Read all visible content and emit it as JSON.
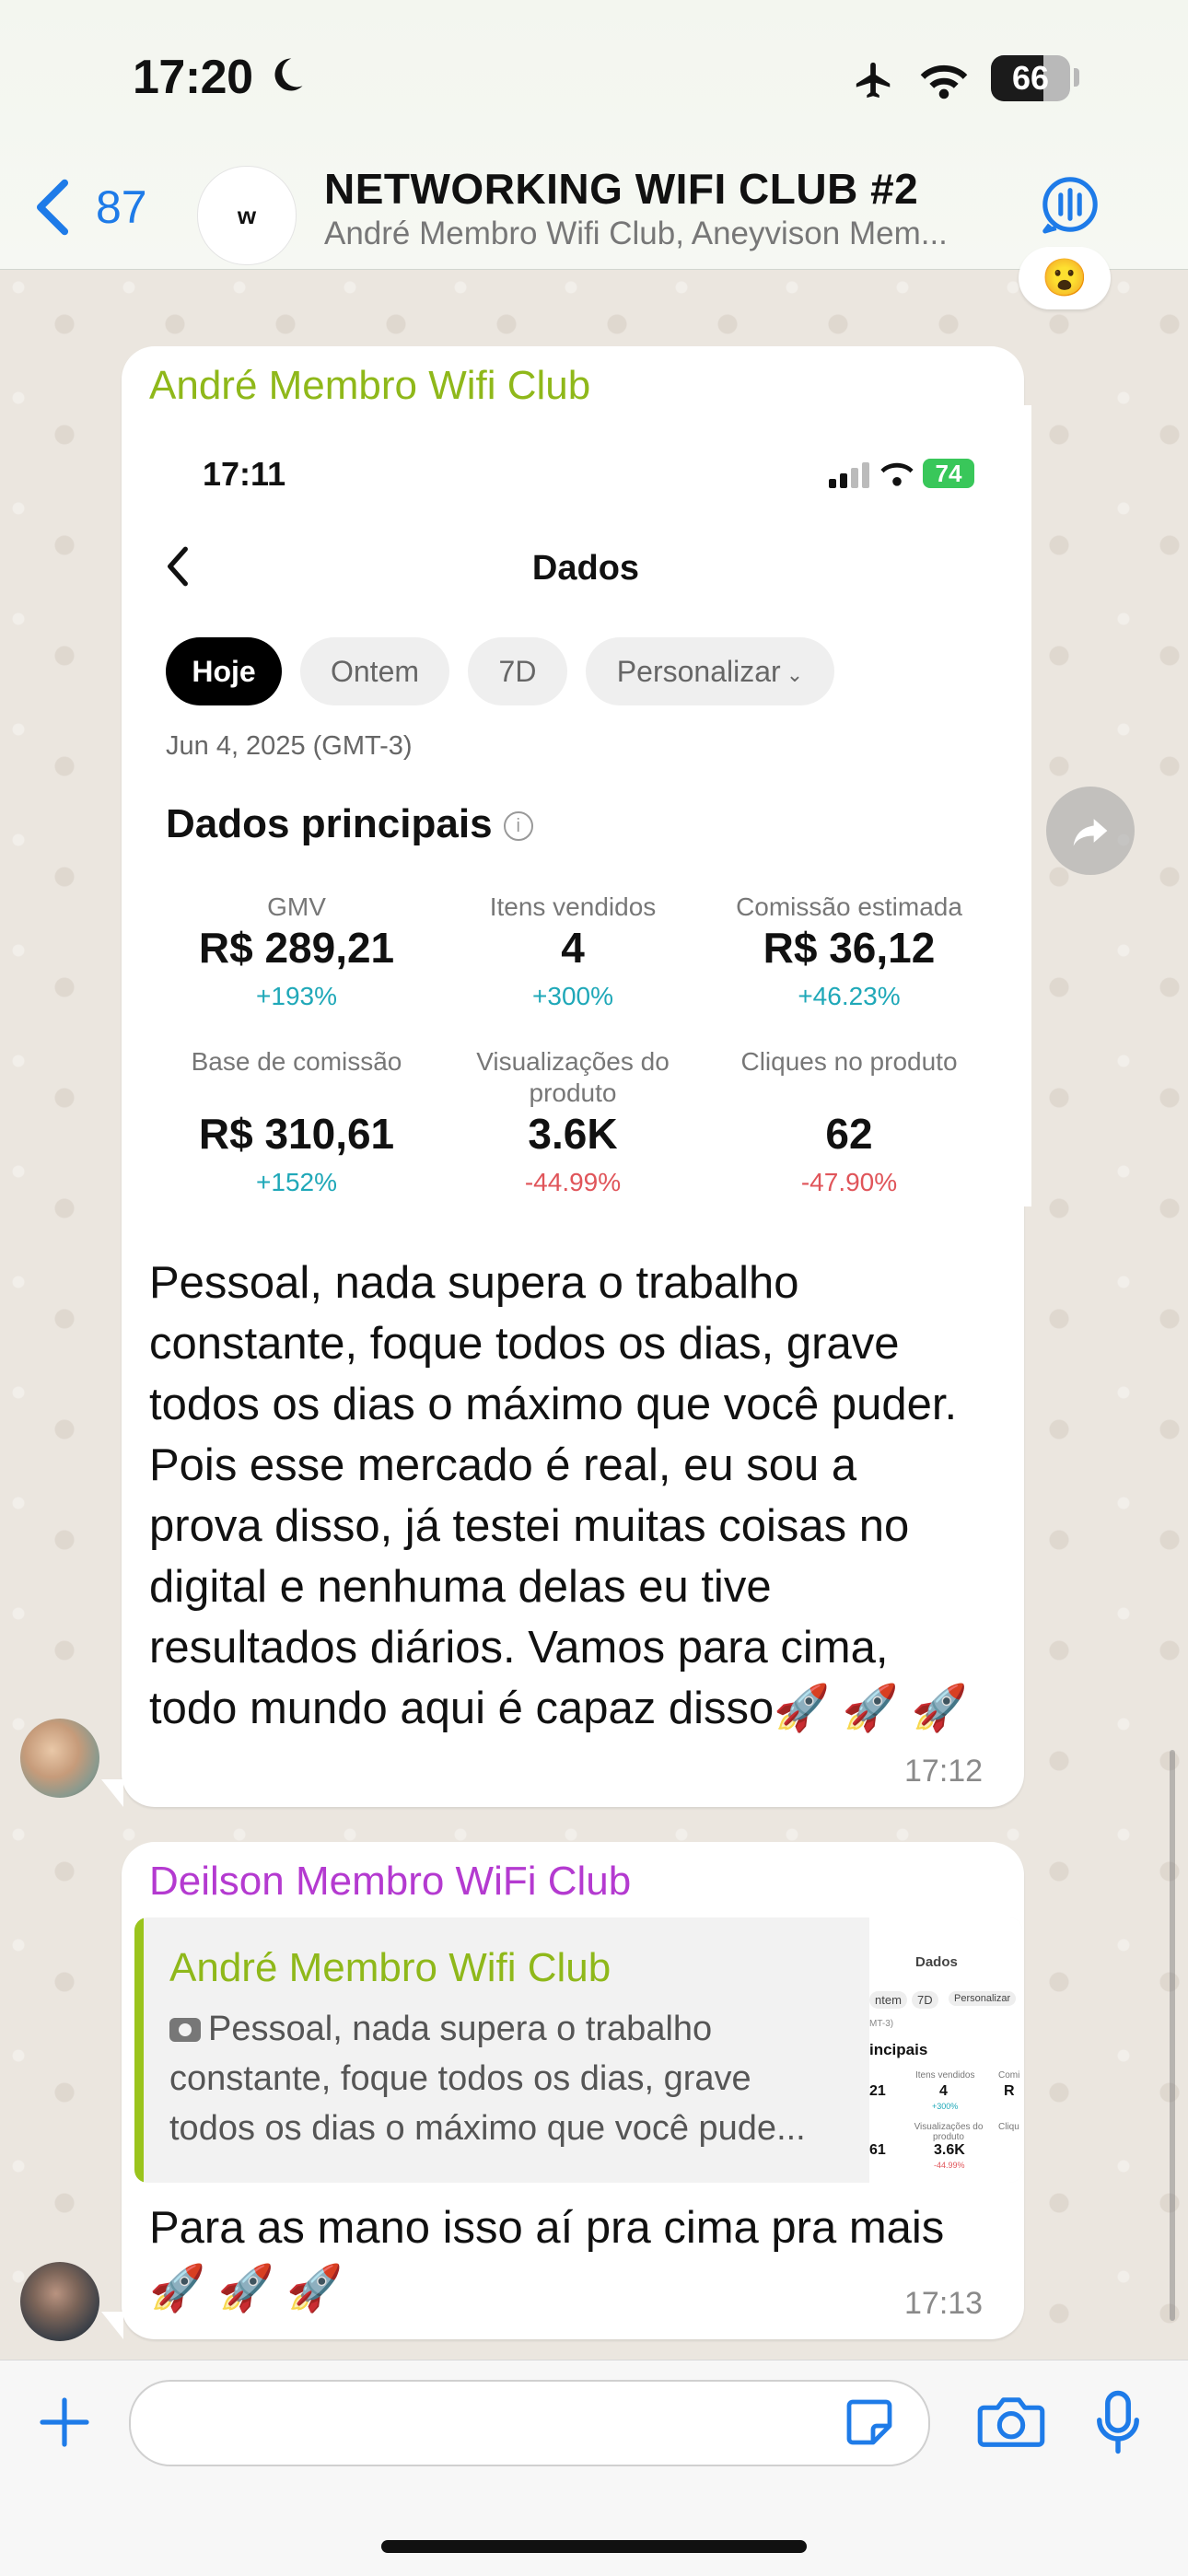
{
  "status_bar": {
    "time": "17:20",
    "battery": "66",
    "battery_level": 0.66
  },
  "header": {
    "back_count": "87",
    "group_avatar_text": "w",
    "title": "NETWORKING WIFI CLUB #2",
    "subtitle": "André Membro Wifi Club, Aneyvison Mem..."
  },
  "reaction_emoji": "😮",
  "message1": {
    "sender": "André Membro Wifi Club",
    "sender_color": "#8fb81a",
    "screenshot": {
      "time": "17:11",
      "battery": "74",
      "title": "Dados",
      "tabs": [
        "Hoje",
        "Ontem",
        "7D",
        "Personalizar"
      ],
      "active_tab": "Hoje",
      "date": "Jun 4, 2025 (GMT-3)",
      "section_title": "Dados principais",
      "metrics": [
        {
          "label": "GMV",
          "value": "R$ 289,21",
          "delta": "+193%"
        },
        {
          "label": "Itens vendidos",
          "value": "4",
          "delta": "+300%"
        },
        {
          "label": "Comissão estimada",
          "value": "R$ 36,12",
          "delta": "+46.23%"
        },
        {
          "label": "Base de comissão",
          "value": "R$ 310,61",
          "delta": "+152%"
        },
        {
          "label": "Visualizações do produto",
          "value": "3.6K",
          "delta": "-44.99%"
        },
        {
          "label": "Cliques no produto",
          "value": "62",
          "delta": "-47.90%"
        }
      ]
    },
    "text_lines": [
      "Pessoal, nada supera o trabalho",
      "constante, foque todos os dias, grave",
      "todos os dias o máximo que você puder.",
      "Pois esse mercado é real, eu sou a",
      "prova disso, já testei muitas coisas no",
      "digital e nenhuma delas eu tive",
      "resultados diários. Vamos para cima,",
      "todo mundo aqui é capaz disso🚀 🚀 🚀"
    ],
    "time": "17:12"
  },
  "message2": {
    "sender": "Deilson Membro WiFi Club",
    "sender_color": "#b43ad0",
    "quote": {
      "sender": "André Membro Wifi Club",
      "lines": [
        "Pessoal, nada supera o trabalho",
        "constante, foque todos os dias, grave",
        "todos os dias o máximo que você pude..."
      ],
      "thumb": {
        "title": "Dados",
        "tabs": [
          "ntem",
          "7D",
          "Personalizar"
        ],
        "tz": "MT-3)",
        "section": "incipais",
        "labels": [
          "Itens vendidos",
          "Visualizações do produto",
          "Comi",
          "Cliqu"
        ],
        "values": [
          "21",
          "4",
          "R",
          "61",
          "3.6K"
        ],
        "deltas": [
          "+300%",
          "-44.99%"
        ]
      }
    },
    "text_lines": [
      "Para as mano isso aí pra cima pra mais",
      "🚀 🚀 🚀"
    ],
    "time": "17:13"
  },
  "colors": {
    "accent": "#1e7be8",
    "chat_bg": "#ebe6df",
    "positive": "#1fa8b8",
    "negative": "#e0555a"
  }
}
